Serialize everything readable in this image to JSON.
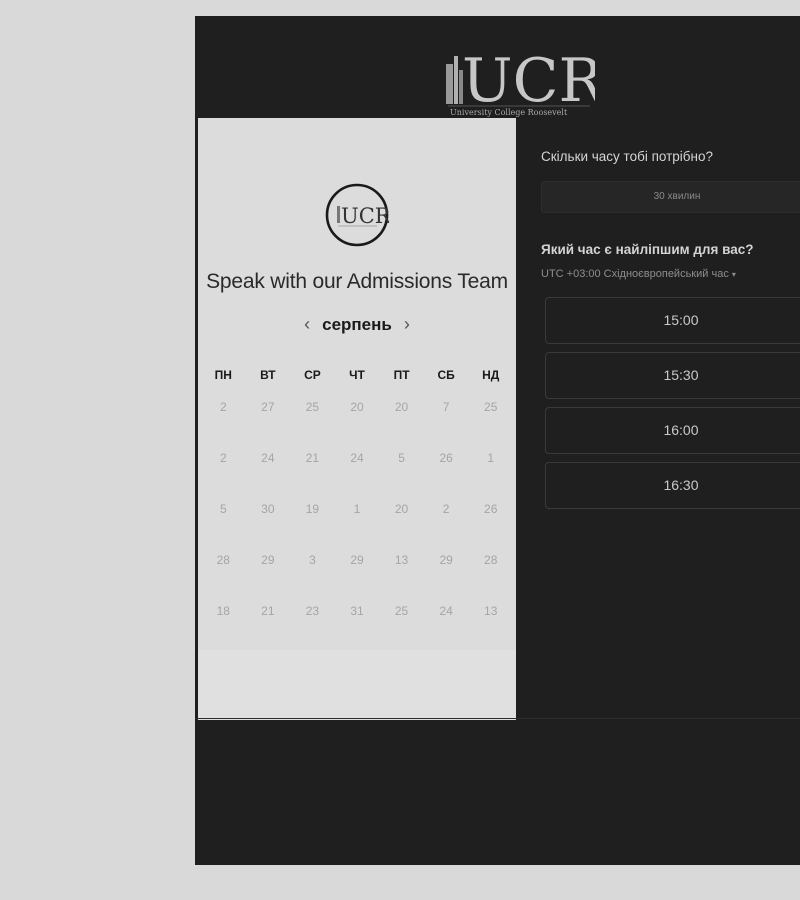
{
  "header": {
    "logo_text": "UCR",
    "logo_subtitle": "University College Roosevelt"
  },
  "calendar": {
    "logo_text": "UCR",
    "title": "Speak with our Admissions Team",
    "prev_icon": "chevron-left-icon",
    "next_icon": "chevron-right-icon",
    "prev_arrow": "‹",
    "next_arrow": "›",
    "month": "серпень",
    "weekdays": [
      "ПН",
      "ВТ",
      "СР",
      "ЧТ",
      "ПТ",
      "СБ",
      "НД"
    ],
    "weeks": [
      [
        "2",
        "27",
        "25",
        "20",
        "20",
        "7",
        "25"
      ],
      [
        "2",
        "24",
        "21",
        "24",
        "5",
        "26",
        "1"
      ],
      [
        "5",
        "30",
        "19",
        "1",
        "20",
        "2",
        "26"
      ],
      [
        "28",
        "29",
        "3",
        "29",
        "13",
        "29",
        "28"
      ],
      [
        "18",
        "21",
        "23",
        "31",
        "25",
        "24",
        "13"
      ]
    ]
  },
  "booking": {
    "duration_question": "Скільки часу тобі потрібно?",
    "duration_value": "30 хвилин",
    "time_question": "Який час є найліпшим для вас?",
    "timezone": "UTC +03:00 Східноєвропейський час",
    "timezone_caret": "▾",
    "slots": [
      "15:00",
      "15:30",
      "16:00",
      "16:30"
    ]
  }
}
